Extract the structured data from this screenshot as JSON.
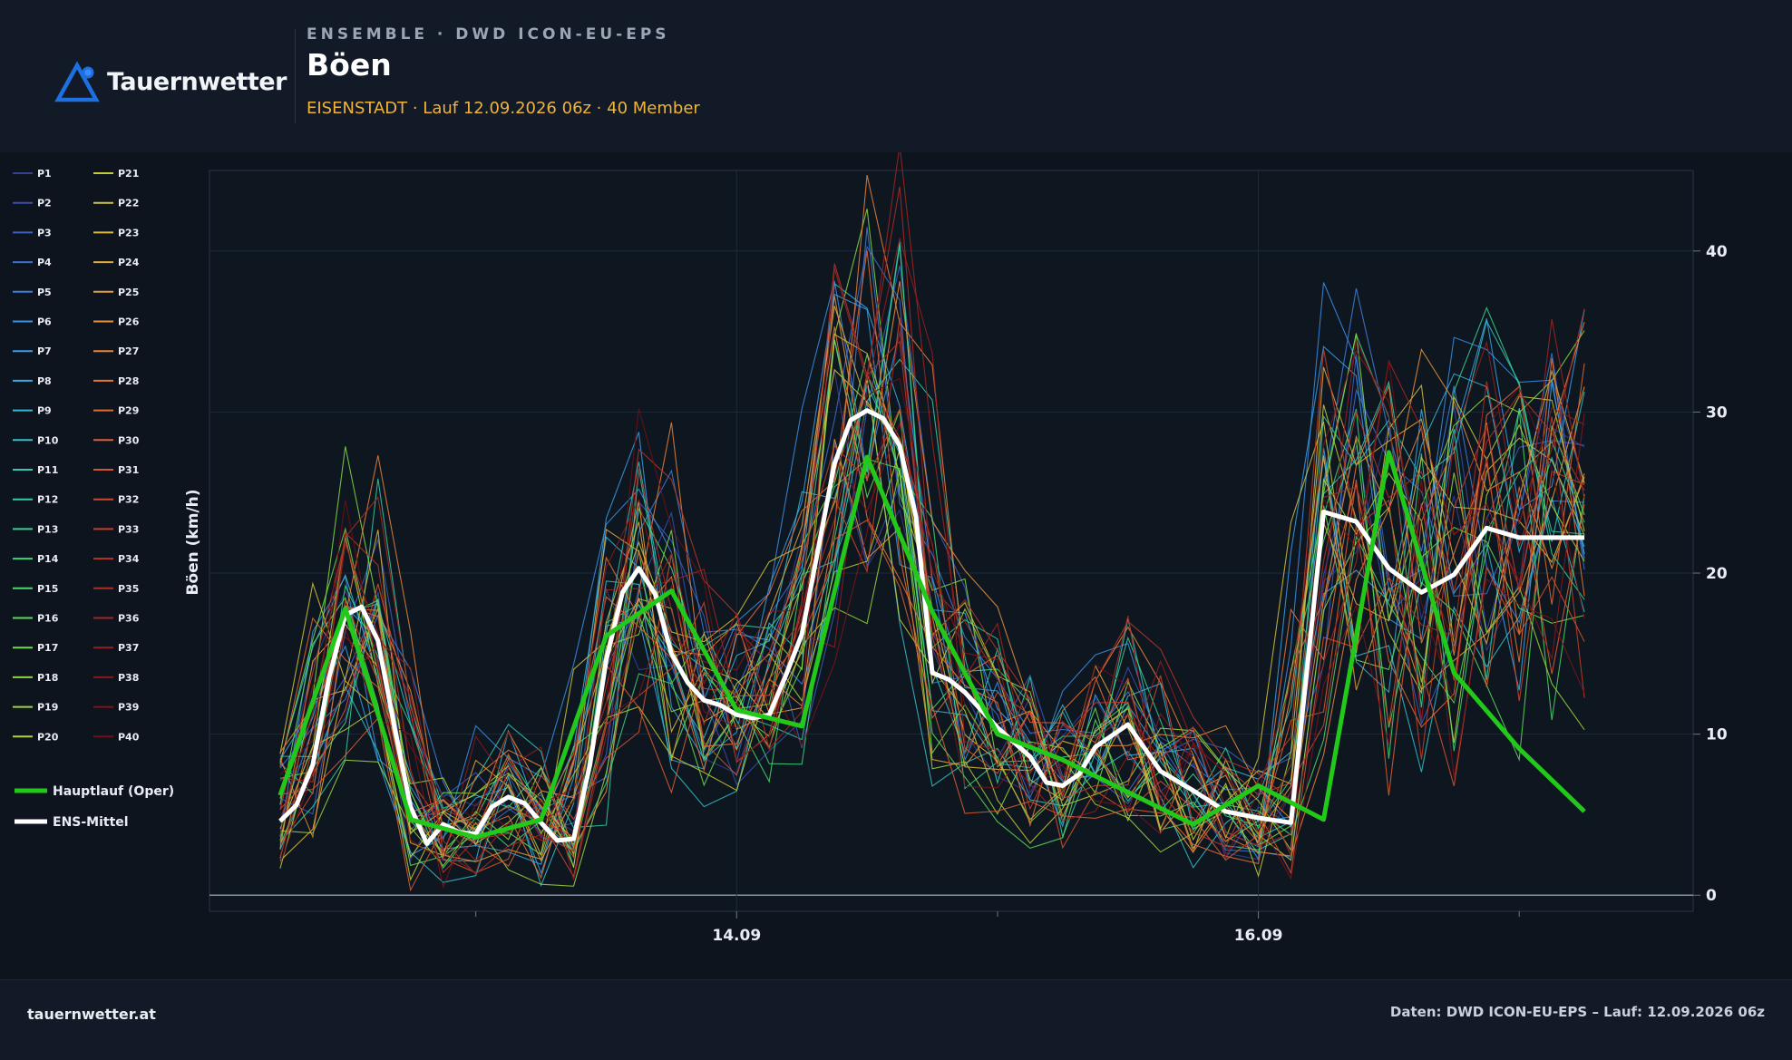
{
  "header": {
    "brand": "Tauernwetter",
    "kicker": "ENSEMBLE · DWD ICON-EU-EPS",
    "title": "Böen",
    "subtitle": "EISENSTADT · Lauf 12.09.2026 06z · 40 Member"
  },
  "footer": {
    "left": "tauernwetter.at",
    "right": "Daten: DWD ICON-EU-EPS – Lauf: 12.09.2026 06z"
  },
  "colors": {
    "background": "#0e141e",
    "panel": "#111a26",
    "accent": "#f0b43c",
    "logo": "#1e6fe0",
    "oper": "#22c91a",
    "mean": "#ffffff"
  },
  "chart_data": {
    "type": "line",
    "ylabel": "Böen (km/h)",
    "xlabel": "",
    "ylim": [
      -1,
      45
    ],
    "y_ticks": [
      0,
      10,
      20,
      30,
      40
    ],
    "x_range_hours": [
      -6.5,
      130
    ],
    "x_ticks": [
      {
        "hours": 42,
        "label": "14.09"
      },
      {
        "hours": 90,
        "label": "16.09"
      }
    ],
    "x_minor_ticks_hours": [
      18,
      66,
      114
    ],
    "grid": true,
    "legend_position": "left",
    "member_count": 40,
    "member_labels": [
      "P1",
      "P2",
      "P3",
      "P4",
      "P5",
      "P6",
      "P7",
      "P8",
      "P9",
      "P10",
      "P11",
      "P12",
      "P13",
      "P14",
      "P15",
      "P16",
      "P17",
      "P18",
      "P19",
      "P20",
      "P21",
      "P22",
      "P23",
      "P24",
      "P25",
      "P26",
      "P27",
      "P28",
      "P29",
      "P30",
      "P31",
      "P32",
      "P33",
      "P34",
      "P35",
      "P36",
      "P37",
      "P38",
      "P39",
      "P40"
    ],
    "member_palette": [
      "#34418f",
      "#3a4fa8",
      "#3d5fbe",
      "#3f6fd0",
      "#3f7fdc",
      "#3b8fe4",
      "#3a9de6",
      "#3aaae2",
      "#36b6d8",
      "#33bfca",
      "#31c6b8",
      "#32cba4",
      "#37d08f",
      "#3fd47b",
      "#4cd769",
      "#5cd95a",
      "#6fda4d",
      "#86d944",
      "#9bd63d",
      "#b0d23a",
      "#c2cc39",
      "#d1c33a",
      "#dcb83b",
      "#e3ab3c",
      "#e79e3c",
      "#e9903b",
      "#e9833a",
      "#e77638",
      "#e36a36",
      "#dd5e33",
      "#d65330",
      "#ce482d",
      "#c43e2a",
      "#b93527",
      "#ad2d24",
      "#a12621",
      "#951f1e",
      "#88191b",
      "#7c1418",
      "#701015"
    ],
    "x_hours": [
      0,
      3,
      6,
      9,
      12,
      15,
      18,
      21,
      24,
      27,
      30,
      33,
      36,
      39,
      42,
      45,
      48,
      51,
      54,
      57,
      60,
      63,
      66,
      69,
      72,
      75,
      78,
      81,
      84,
      87,
      90,
      93,
      96,
      99,
      102,
      105,
      108,
      111,
      114,
      117,
      120
    ],
    "series": [
      {
        "name": "Hauptlauf (Oper)",
        "x_hours": [
          0,
          6,
          12,
          18,
          24,
          30,
          36,
          42,
          48,
          54,
          60,
          66,
          72,
          78,
          84,
          90,
          96,
          102,
          108,
          114,
          120
        ],
        "values": [
          6.2,
          17.8,
          4.7,
          3.6,
          4.7,
          16.1,
          18.9,
          11.5,
          10.5,
          27.2,
          17.6,
          10.0,
          8.4,
          6.4,
          4.4,
          6.8,
          4.7,
          27.5,
          13.8,
          9.1,
          5.2
        ]
      },
      {
        "name": "ENS-Mittel",
        "x_hours": [
          0,
          1.5,
          3,
          4.5,
          6,
          7.5,
          9,
          10.5,
          12,
          13.5,
          15,
          16.5,
          18,
          19.5,
          21,
          22.5,
          24,
          25.5,
          27,
          28.5,
          30,
          31.5,
          33,
          34.5,
          36,
          37.5,
          39,
          40.5,
          42,
          43.5,
          45,
          46.5,
          48,
          49.5,
          51,
          52.5,
          54,
          55.5,
          57,
          58.5,
          60,
          61.5,
          63,
          66,
          69,
          70.5,
          72,
          73.5,
          75,
          78,
          81,
          84,
          87,
          90,
          93,
          96,
          99,
          102,
          105,
          108,
          111,
          114,
          117,
          120
        ],
        "values": [
          4.6,
          5.6,
          8.1,
          13.5,
          17.4,
          17.9,
          15.8,
          10.5,
          5.5,
          3.2,
          4.4,
          3.9,
          3.8,
          5.5,
          6.1,
          5.7,
          4.5,
          3.4,
          3.5,
          8.1,
          14.6,
          18.8,
          20.3,
          18.7,
          15.0,
          13.2,
          12.1,
          11.8,
          11.2,
          11.0,
          11.2,
          13.6,
          16.2,
          21.5,
          26.8,
          29.5,
          30.1,
          29.6,
          27.9,
          23.5,
          13.8,
          13.4,
          12.6,
          10.4,
          8.6,
          7.0,
          6.8,
          7.5,
          9.2,
          10.6,
          7.7,
          6.5,
          5.2,
          4.8,
          4.5,
          23.8,
          23.2,
          20.3,
          18.8,
          19.9,
          22.8,
          22.2,
          22.2,
          22.2
        ]
      }
    ]
  },
  "legend": {
    "oper_label": "Hauptlauf (Oper)",
    "mean_label": "ENS-Mittel"
  }
}
